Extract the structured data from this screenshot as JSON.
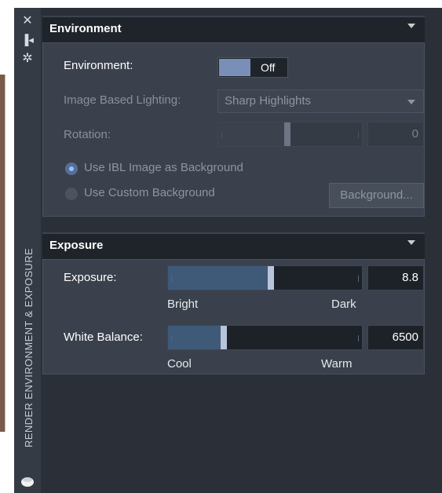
{
  "palette": {
    "title": "RENDER ENVIRONMENT & EXPOSURE"
  },
  "environment": {
    "header": "Environment",
    "env_label": "Environment:",
    "env_toggle": "Off",
    "ibl_label": "Image Based Lighting:",
    "ibl_value": "Sharp Highlights",
    "rotation_label": "Rotation:",
    "rotation_value": "0",
    "rotation_level": 0.48,
    "radio1": "Use IBL Image as Background",
    "radio2": "Use Custom Background",
    "background_button": "Background..."
  },
  "exposure": {
    "header": "Exposure",
    "exposure_label": "Exposure:",
    "exposure_value": "8.8",
    "exposure_level": 0.53,
    "exposure_left": "Bright",
    "exposure_right": "Dark",
    "wb_label": "White Balance:",
    "wb_value": "6500",
    "wb_level": 0.28,
    "wb_left": "Cool",
    "wb_right": "Warm"
  },
  "colors": {
    "panel_bg": "#2b3038",
    "section_bg": "#3a414c",
    "slider_fill": "#3f5a79",
    "toggle_accent": "#7a8fb8"
  }
}
